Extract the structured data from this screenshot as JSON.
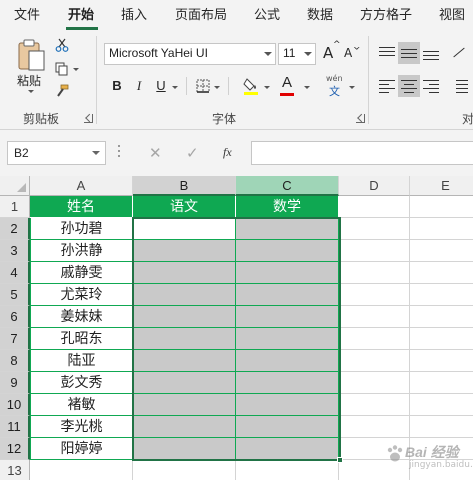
{
  "ribbon_tabs": [
    "文件",
    "开始",
    "插入",
    "页面布局",
    "公式",
    "数据",
    "方方格子",
    "视图"
  ],
  "active_tab": "开始",
  "clipboard": {
    "paste_label": "粘贴",
    "group_label": "剪贴板"
  },
  "font": {
    "family": "Microsoft YaHei UI",
    "size": "11",
    "grow_label": "A",
    "shrink_label": "A",
    "bold_label": "B",
    "italic_label": "I",
    "underline_label": "U",
    "font_color_label": "A",
    "phonetic_top": "wén",
    "phonetic_char": "文",
    "group_label": "字体"
  },
  "alignment": {
    "group_label_partial": "对"
  },
  "formula_bar": {
    "name_box": "B2",
    "cancel_icon": "✕",
    "enter_icon": "✓",
    "fx_label": "fx",
    "formula": ""
  },
  "columns": [
    "A",
    "B",
    "C",
    "D",
    "E"
  ],
  "rows": [
    "1",
    "2",
    "3",
    "4",
    "5",
    "6",
    "7",
    "8",
    "9",
    "10",
    "11",
    "12",
    "13"
  ],
  "table": {
    "headers": [
      "姓名",
      "语文",
      "数学"
    ],
    "names": [
      "孙功碧",
      "孙洪静",
      "戚静雯",
      "尤菜玲",
      "姜妹妹",
      "孔昭东",
      "陆亚",
      "彭文秀",
      "褚敏",
      "李光桃",
      "阳婷婷"
    ]
  },
  "selection": {
    "active_cell": "B2",
    "range": "B2:C12"
  },
  "colors": {
    "accent": "#217346",
    "header_fill": "#0fa852",
    "selection_fill": "#c9c9c9"
  },
  "watermark": {
    "brand": "Bai 经验",
    "sub": "jingyan.baidu.com"
  }
}
